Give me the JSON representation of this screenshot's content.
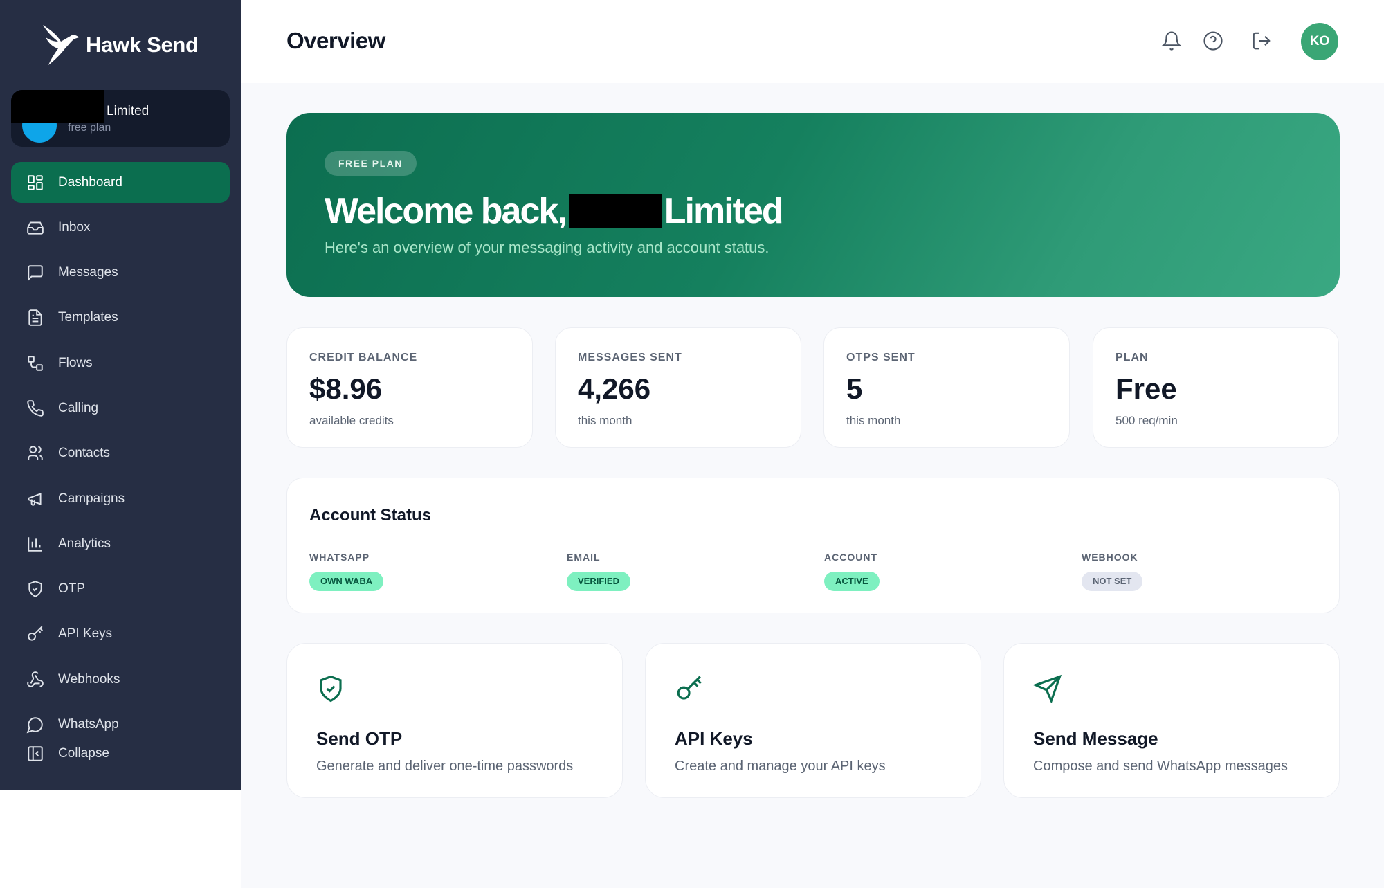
{
  "brand": {
    "name": "Hawk Send"
  },
  "account": {
    "name": "Limited",
    "plan": "free plan"
  },
  "sidebar": {
    "items": [
      {
        "label": "Dashboard",
        "icon": "dashboard-icon",
        "active": true
      },
      {
        "label": "Inbox",
        "icon": "inbox-icon"
      },
      {
        "label": "Messages",
        "icon": "message-square-icon"
      },
      {
        "label": "Templates",
        "icon": "file-text-icon"
      },
      {
        "label": "Flows",
        "icon": "flow-icon"
      },
      {
        "label": "Calling",
        "icon": "phone-icon"
      },
      {
        "label": "Contacts",
        "icon": "users-icon"
      },
      {
        "label": "Campaigns",
        "icon": "megaphone-icon"
      },
      {
        "label": "Analytics",
        "icon": "bar-chart-icon"
      },
      {
        "label": "OTP",
        "icon": "shield-check-icon"
      },
      {
        "label": "API Keys",
        "icon": "key-icon"
      },
      {
        "label": "Webhooks",
        "icon": "webhook-icon"
      },
      {
        "label": "WhatsApp",
        "icon": "whatsapp-icon"
      }
    ],
    "collapse_label": "Collapse"
  },
  "header": {
    "title": "Overview",
    "icons": [
      "bell-icon",
      "help-circle-icon",
      "logout-icon"
    ],
    "avatar_initials": "KO"
  },
  "hero": {
    "badge": "FREE PLAN",
    "title_prefix": "Welcome back,",
    "title_suffix": "Limited",
    "subtitle": "Here's an overview of your messaging activity and account status."
  },
  "stats": [
    {
      "label": "CREDIT BALANCE",
      "value": "$8.96",
      "sub": "available credits"
    },
    {
      "label": "MESSAGES SENT",
      "value": "4,266",
      "sub": "this month"
    },
    {
      "label": "OTPS SENT",
      "value": "5",
      "sub": "this month"
    },
    {
      "label": "PLAN",
      "value": "Free",
      "sub": "500 req/min"
    }
  ],
  "account_status": {
    "title": "Account Status",
    "items": [
      {
        "label": "WHATSAPP",
        "value": "OWN WABA",
        "tone": "green"
      },
      {
        "label": "EMAIL",
        "value": "VERIFIED",
        "tone": "green"
      },
      {
        "label": "ACCOUNT",
        "value": "ACTIVE",
        "tone": "green"
      },
      {
        "label": "WEBHOOK",
        "value": "NOT SET",
        "tone": "gray"
      }
    ]
  },
  "actions": [
    {
      "title": "Send OTP",
      "desc": "Generate and deliver one-time passwords",
      "icon": "shield-check-icon"
    },
    {
      "title": "API Keys",
      "desc": "Create and manage your API keys",
      "icon": "key-icon"
    },
    {
      "title": "Send Message",
      "desc": "Compose and send WhatsApp messages",
      "icon": "send-icon"
    }
  ],
  "colors": {
    "sidebar_bg": "#262e44",
    "accent": "#0b6e4f",
    "avatar": "#3aa675",
    "pill_green": "#7ef0c0"
  }
}
